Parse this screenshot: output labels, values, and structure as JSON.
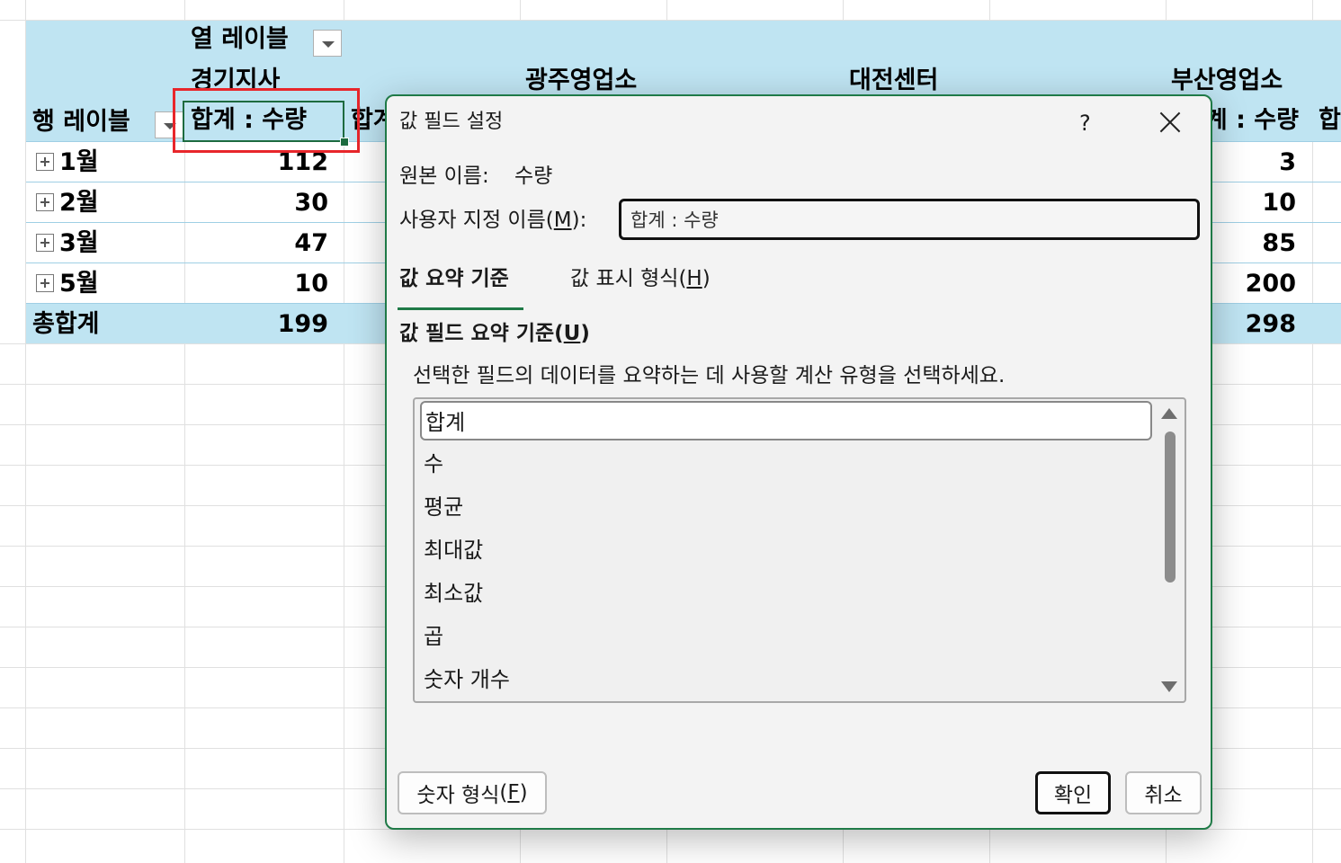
{
  "pivot": {
    "col_label_header": "열 레이블",
    "row_label_header": "행 레이블",
    "groups": [
      "경기지사",
      "광주영업소",
      "대전센터",
      "부산영업소"
    ],
    "value_header": "합계 : 수량",
    "value_header_partial_next": "합계",
    "value_header_partial_right": "합계 : 수량",
    "value_header_partial_far": "합",
    "rows": [
      {
        "label": "1월",
        "col1": "112",
        "right": "3"
      },
      {
        "label": "2월",
        "col1": "30",
        "right": "10"
      },
      {
        "label": "3월",
        "col1": "47",
        "right": "85"
      },
      {
        "label": "5월",
        "col1": "10",
        "right": "200"
      }
    ],
    "total": {
      "label": "총합계",
      "col1": "199",
      "right": "298"
    }
  },
  "dialog": {
    "title": "값 필드 설정",
    "help": "?",
    "source_label": "원본 이름:",
    "source_value": "수량",
    "custom_label": "사용자 지정 이름",
    "custom_mnemonic": "M",
    "custom_value": "합계 : 수량",
    "tab_summarize": "값 요약 기준",
    "tab_show_as": "값 표시 형식",
    "tab_show_as_mnemonic": "H",
    "section_title": "값 필드 요약 기준",
    "section_mnemonic": "U",
    "description": "선택한 필드의 데이터를 요약하는 데 사용할 계산 유형을 선택하세요.",
    "functions": [
      "합계",
      "수",
      "평균",
      "최대값",
      "최소값",
      "곱",
      "숫자 개수"
    ],
    "selected_index": 0,
    "number_format": "숫자 형식",
    "number_format_mnemonic": "F",
    "ok": "확인",
    "cancel": "취소"
  },
  "colors": {
    "accent": "#1f7a47",
    "pivot_band": "#bfe4f2",
    "highlight": "#e8262b"
  }
}
